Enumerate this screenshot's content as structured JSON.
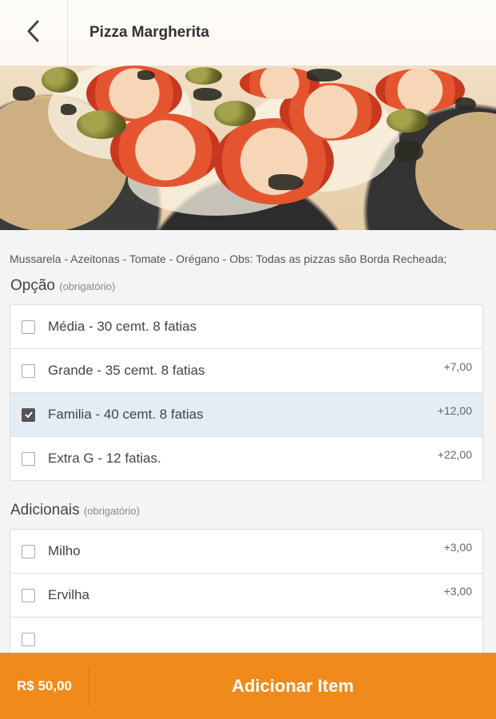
{
  "header": {
    "title": "Pizza Margherita",
    "back_icon": "chevron-left-icon"
  },
  "product": {
    "image_alt": "pizza-photo",
    "description": "Mussarela - Azeitonas - Tomate - Orégano - Obs: Todas as pizzas são Borda Recheada;"
  },
  "option_group": {
    "title": "Opção",
    "required_label": "(obrigatório)",
    "items": [
      {
        "label": "Média - 30 cemt. 8 fatias",
        "price": "",
        "checked": false
      },
      {
        "label": "Grande - 35 cemt. 8 fatias",
        "price": "+7,00",
        "checked": false
      },
      {
        "label": "Familia - 40 cemt. 8 fatias",
        "price": "+12,00",
        "checked": true
      },
      {
        "label": "Extra G - 12 fatias.",
        "price": "+22,00",
        "checked": false
      }
    ]
  },
  "addons_group": {
    "title": "Adicionais",
    "required_label": "(obrigatório)",
    "items": [
      {
        "label": "Milho",
        "price": "+3,00",
        "checked": false
      },
      {
        "label": "Ervilha",
        "price": "+3,00",
        "checked": false
      },
      {
        "label": "",
        "price": "",
        "checked": false
      }
    ]
  },
  "footer": {
    "total": "R$ 50,00",
    "add_label": "Adicionar Item"
  },
  "colors": {
    "accent": "#f08a1b",
    "selected_row": "#e4edf4"
  }
}
